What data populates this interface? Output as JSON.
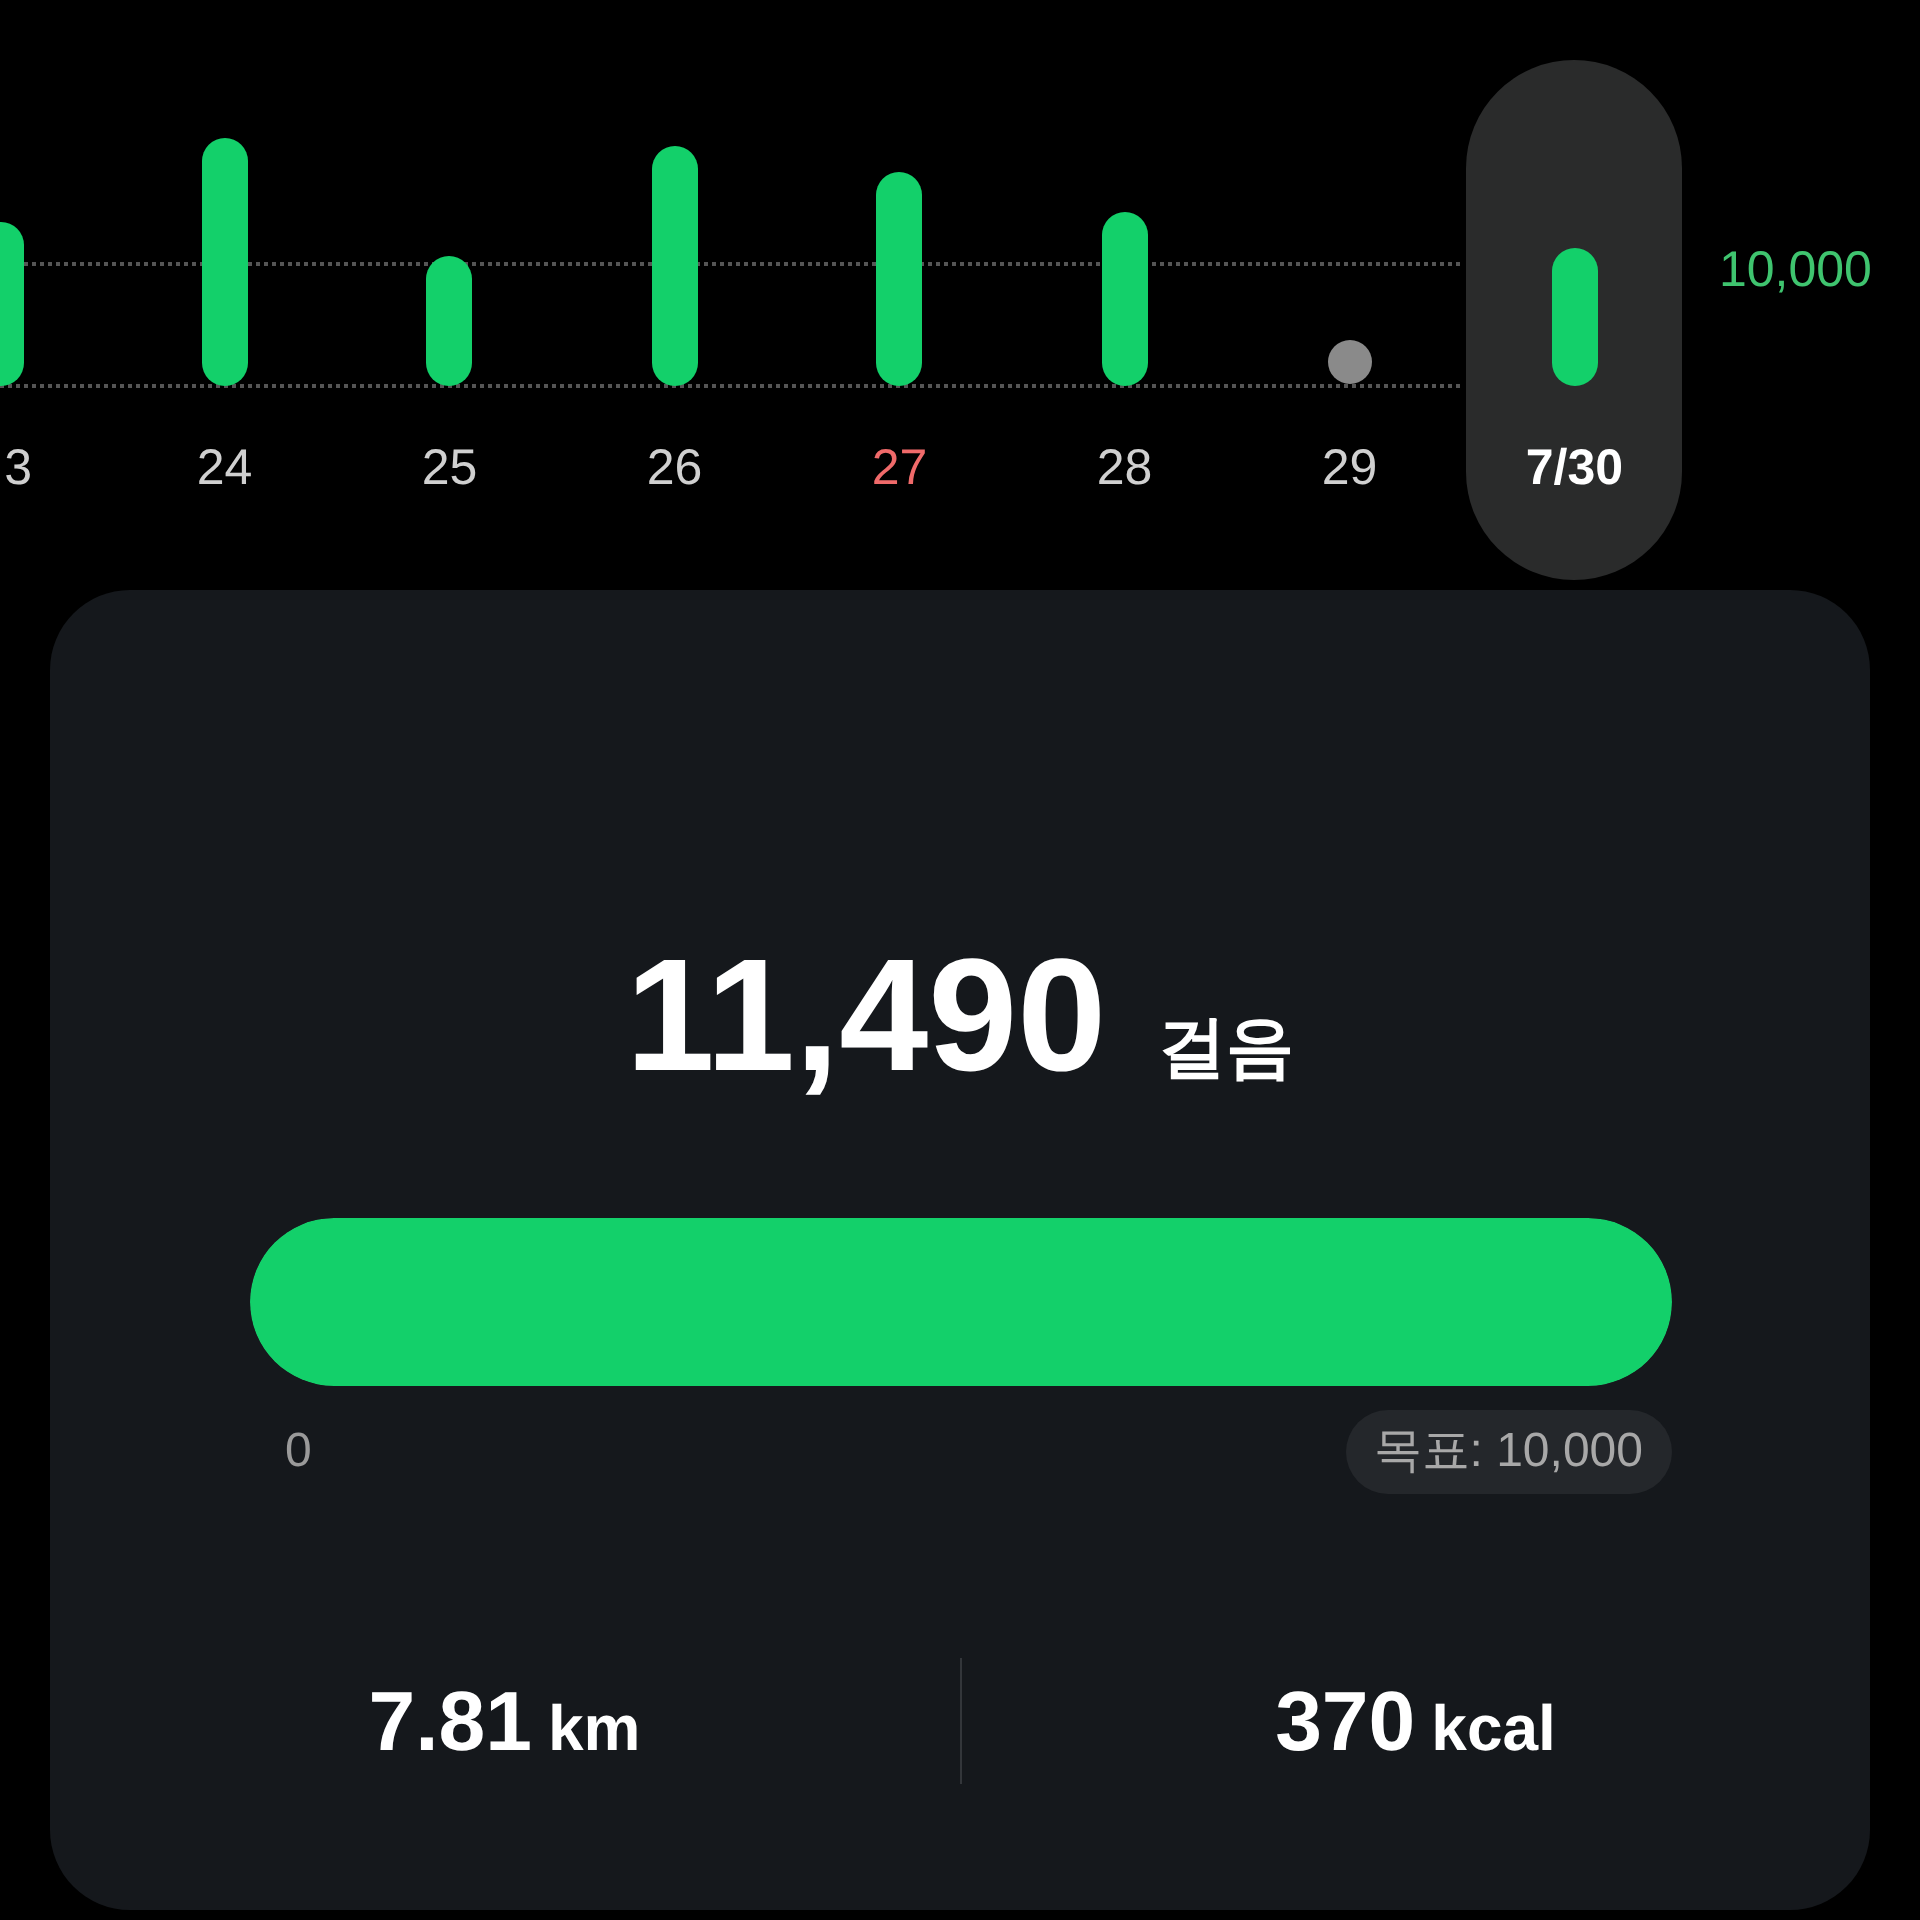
{
  "chart": {
    "goal_label": "10,000",
    "days": [
      {
        "label": "3",
        "kind": "bar",
        "selected": false,
        "color": "#d0d0d0"
      },
      {
        "label": "24",
        "kind": "bar",
        "selected": false,
        "color": "#d0d0d0"
      },
      {
        "label": "25",
        "kind": "bar",
        "selected": false,
        "color": "#d0d0d0"
      },
      {
        "label": "26",
        "kind": "bar",
        "selected": false,
        "color": "#d0d0d0"
      },
      {
        "label": "27",
        "kind": "bar",
        "selected": false,
        "color": "#f06a6a"
      },
      {
        "label": "28",
        "kind": "bar",
        "selected": false,
        "color": "#d0d0d0"
      },
      {
        "label": "29",
        "kind": "dot",
        "selected": false,
        "color": "#d0d0d0"
      },
      {
        "label": "7/30",
        "kind": "bar",
        "selected": true,
        "color": "#ffffff"
      }
    ]
  },
  "summary": {
    "steps": "11,490",
    "steps_unit": "걸음",
    "progress": {
      "level": 1,
      "start": "0",
      "goal": "목표: 10,000"
    },
    "stats": [
      {
        "value": "7.81",
        "unit": "km"
      },
      {
        "value": "370",
        "unit": "kcal"
      }
    ]
  }
}
